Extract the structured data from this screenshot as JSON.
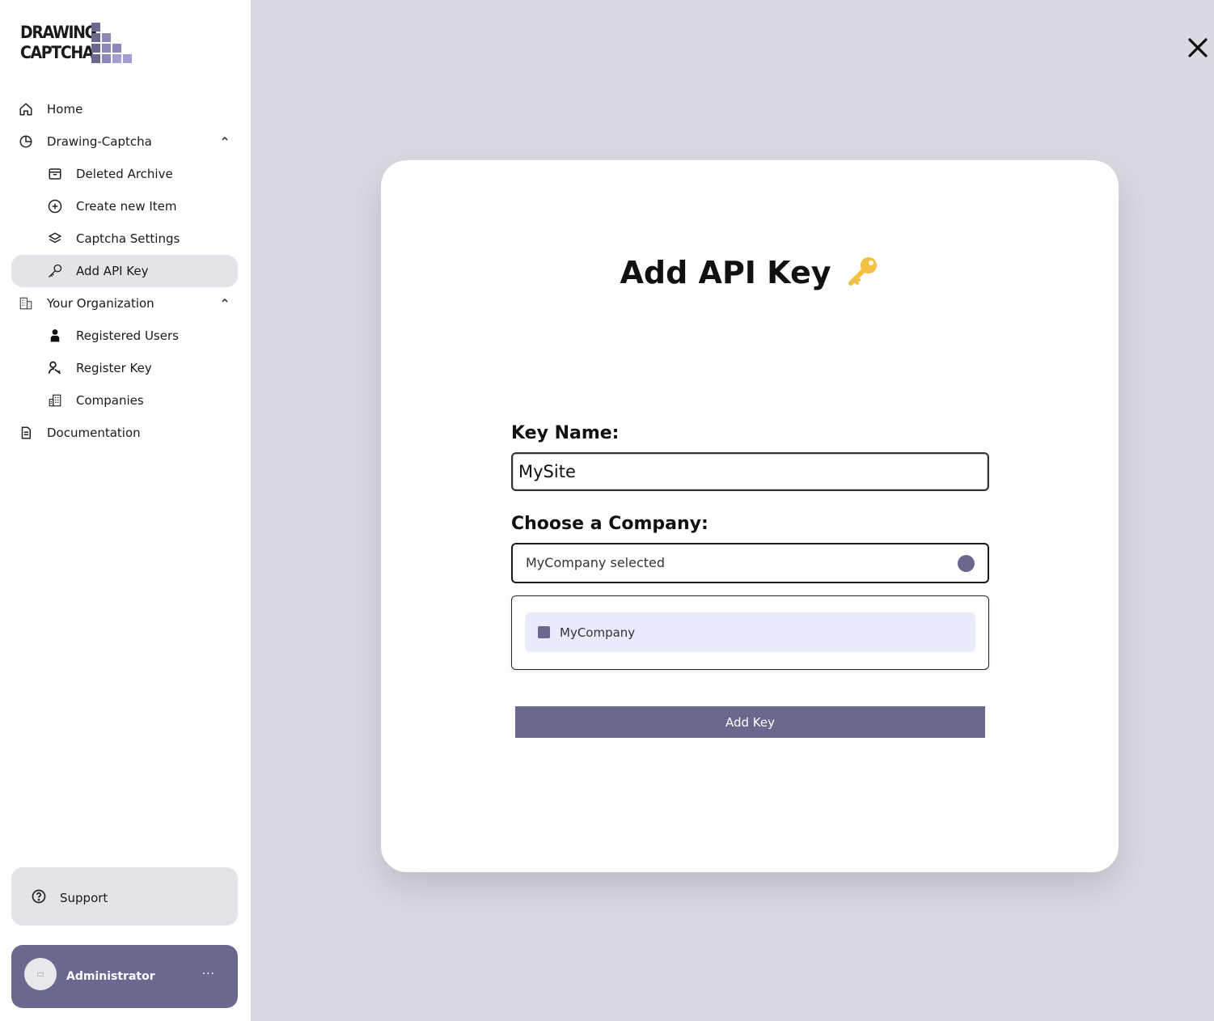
{
  "app": {
    "logo_line1": "DRAWING",
    "logo_line2": "CAPTCHA"
  },
  "sidebar": {
    "items": [
      {
        "label": "Home",
        "icon": "home-icon"
      },
      {
        "label": "Drawing-Captcha",
        "icon": "pie-chart-icon",
        "expanded": true
      },
      {
        "label": "Deleted Archive",
        "icon": "archive-icon"
      },
      {
        "label": "Create new Item",
        "icon": "plus-circle-icon"
      },
      {
        "label": "Captcha Settings",
        "icon": "layers-icon"
      },
      {
        "label": "Add API Key",
        "icon": "key-icon",
        "active": true
      },
      {
        "label": "Your Organization",
        "icon": "building-icon",
        "expanded": true
      },
      {
        "label": "Registered Users",
        "icon": "user-icon"
      },
      {
        "label": "Register Key",
        "icon": "key-person-icon"
      },
      {
        "label": "Companies",
        "icon": "companies-icon"
      },
      {
        "label": "Documentation",
        "icon": "document-icon"
      }
    ],
    "support_label": "Support",
    "user_name": "Administrator",
    "user_more": "···"
  },
  "modal": {
    "title": "Add API Key",
    "key_name_label": "Key Name:",
    "key_name_value": "MySite",
    "company_label": "Choose a Company:",
    "company_selected_text": "MyCompany selected",
    "company_options": [
      "MyCompany"
    ],
    "submit_label": "Add Key"
  },
  "colors": {
    "accent": "#6b6890",
    "background": "#d9d9e1",
    "active_item": "#e3e3ea",
    "option_highlight": "#e8ebfa",
    "key_icon": "#f2c043"
  }
}
